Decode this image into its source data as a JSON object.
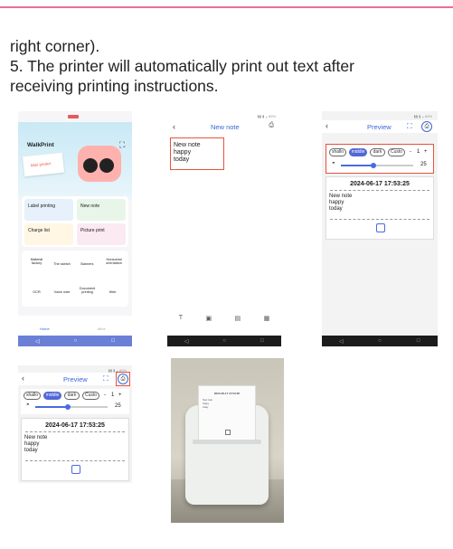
{
  "text": {
    "line1": "right corner).",
    "line2": "5. The printer will automatically print out text after",
    "line3": "receiving printing instructions."
  },
  "home": {
    "brand": "WalkPrint",
    "sticker": "Mini printer",
    "tiles": [
      "Label printing",
      "New note",
      "Charge list",
      "Picture print"
    ],
    "tools": [
      "Material factory",
      "The sketch",
      "Banners",
      "Horizontal orientation",
      "OCR",
      "Voice note",
      "Document printing",
      "Web"
    ],
    "tabs": [
      "Home",
      "Mine"
    ]
  },
  "note": {
    "title": "New note",
    "lines": [
      "New note",
      "happy",
      "today"
    ]
  },
  "preview": {
    "title": "Preview",
    "chips": [
      "shallo",
      "middle",
      "dark",
      "Custo"
    ],
    "copies": "1",
    "minus": "-",
    "plus": "+",
    "slider_value": "25",
    "slider_fraction": 0.45,
    "datetime": "2024-06-17 17:53:25",
    "lines": [
      "New note",
      "happy",
      "today"
    ]
  },
  "colors": {
    "accent": "#3a66d8",
    "highlight": "#e8533d",
    "pink_rule": "#e8709a"
  }
}
